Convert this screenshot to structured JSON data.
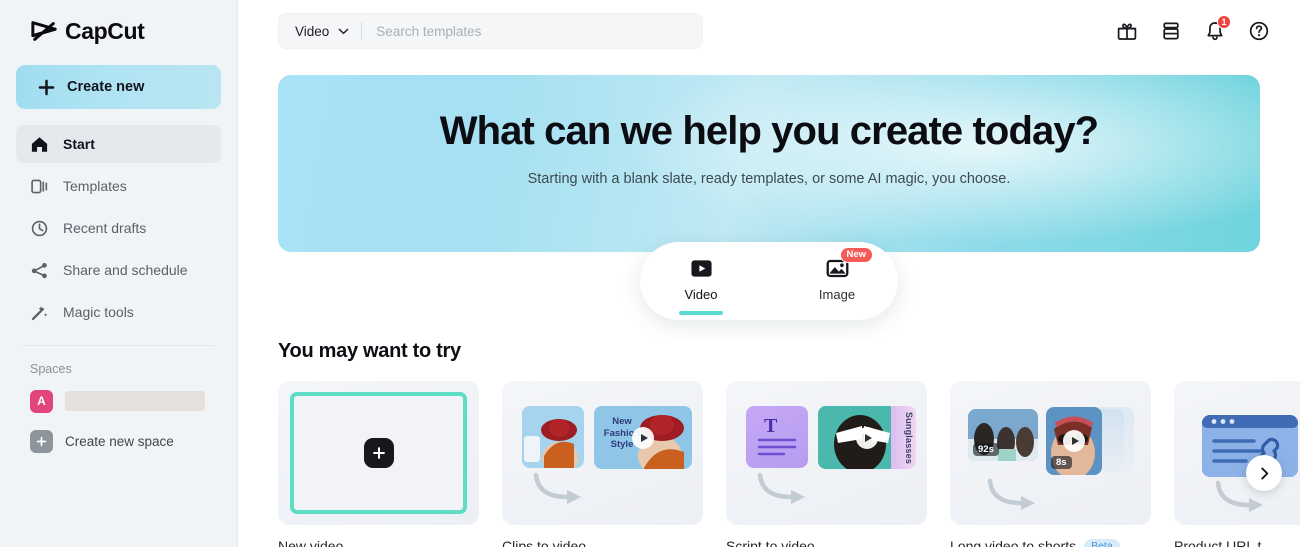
{
  "sidebar": {
    "brand": "CapCut",
    "create_new_label": "Create new",
    "nav_items": [
      {
        "label": "Start",
        "icon": "home-icon",
        "active": true
      },
      {
        "label": "Templates",
        "icon": "templates-icon",
        "active": false
      },
      {
        "label": "Recent drafts",
        "icon": "clock-icon",
        "active": false
      },
      {
        "label": "Share and schedule",
        "icon": "share-icon",
        "active": false
      },
      {
        "label": "Magic tools",
        "icon": "wand-icon",
        "active": false
      }
    ],
    "spaces_title": "Spaces",
    "space_avatar_letter": "A",
    "space_name": "",
    "create_new_space_label": "Create new space"
  },
  "topbar": {
    "search_type": "Video",
    "search_placeholder": "Search templates",
    "search_value": "",
    "icons": [
      {
        "name": "gift-icon",
        "badge": ""
      },
      {
        "name": "box-icon",
        "badge": ""
      },
      {
        "name": "bell-icon",
        "badge": "1"
      },
      {
        "name": "help-icon",
        "badge": ""
      }
    ],
    "notification_count": "1"
  },
  "hero": {
    "title": "What can we help you create today?",
    "subtitle": "Starting with a blank slate, ready templates, or some AI magic, you choose.",
    "accent_color": "#5ad9d1",
    "gradient_from": "#a8e2f4",
    "gradient_to": "#6fd4dd",
    "tabs": [
      {
        "label": "Video",
        "icon": "video-icon",
        "active": true,
        "badge": ""
      },
      {
        "label": "Image",
        "icon": "image-icon",
        "active": false,
        "badge": "New"
      }
    ]
  },
  "section": {
    "title": "You may want to try",
    "cards": [
      {
        "label": "New video",
        "badge": "",
        "kind": "new-video",
        "thumb_texts": []
      },
      {
        "label": "Clips to video",
        "badge": "",
        "kind": "clips",
        "thumb_texts": [
          "New",
          "Fashion",
          "Style"
        ]
      },
      {
        "label": "Script to video",
        "badge": "",
        "kind": "script",
        "thumb_texts": [
          "T",
          "Sunglasses"
        ]
      },
      {
        "label": "Long video to shorts",
        "badge": "Beta",
        "kind": "shorts",
        "thumb_texts": [
          "92s",
          "8s"
        ]
      },
      {
        "label": "Product URL t",
        "badge": "",
        "kind": "product-url",
        "thumb_texts": []
      }
    ],
    "next_label": "›"
  }
}
